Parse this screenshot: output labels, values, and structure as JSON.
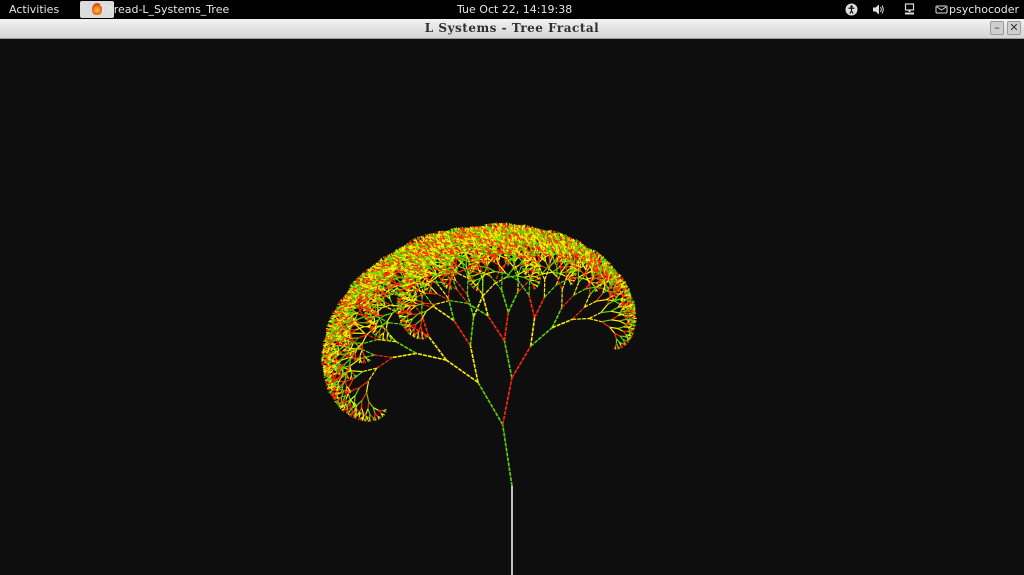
{
  "topbar": {
    "activities": "Activities",
    "app_menu": "Thread-L_Systems_Tree",
    "clock": "Tue Oct 22, 14:19:38",
    "user": "psychocoder",
    "icons": [
      "accessibility-icon",
      "volume-icon",
      "network-icon",
      "user-icon"
    ]
  },
  "window": {
    "title": "L Systems - Tree Fractal",
    "min_symbol": "–",
    "close_symbol": "✕"
  },
  "fractal": {
    "background": "#0e0e0e",
    "trunk_color": "#ffffff",
    "branch_colors": [
      "#ff2a00",
      "#ffee00",
      "#5ed400"
    ]
  }
}
